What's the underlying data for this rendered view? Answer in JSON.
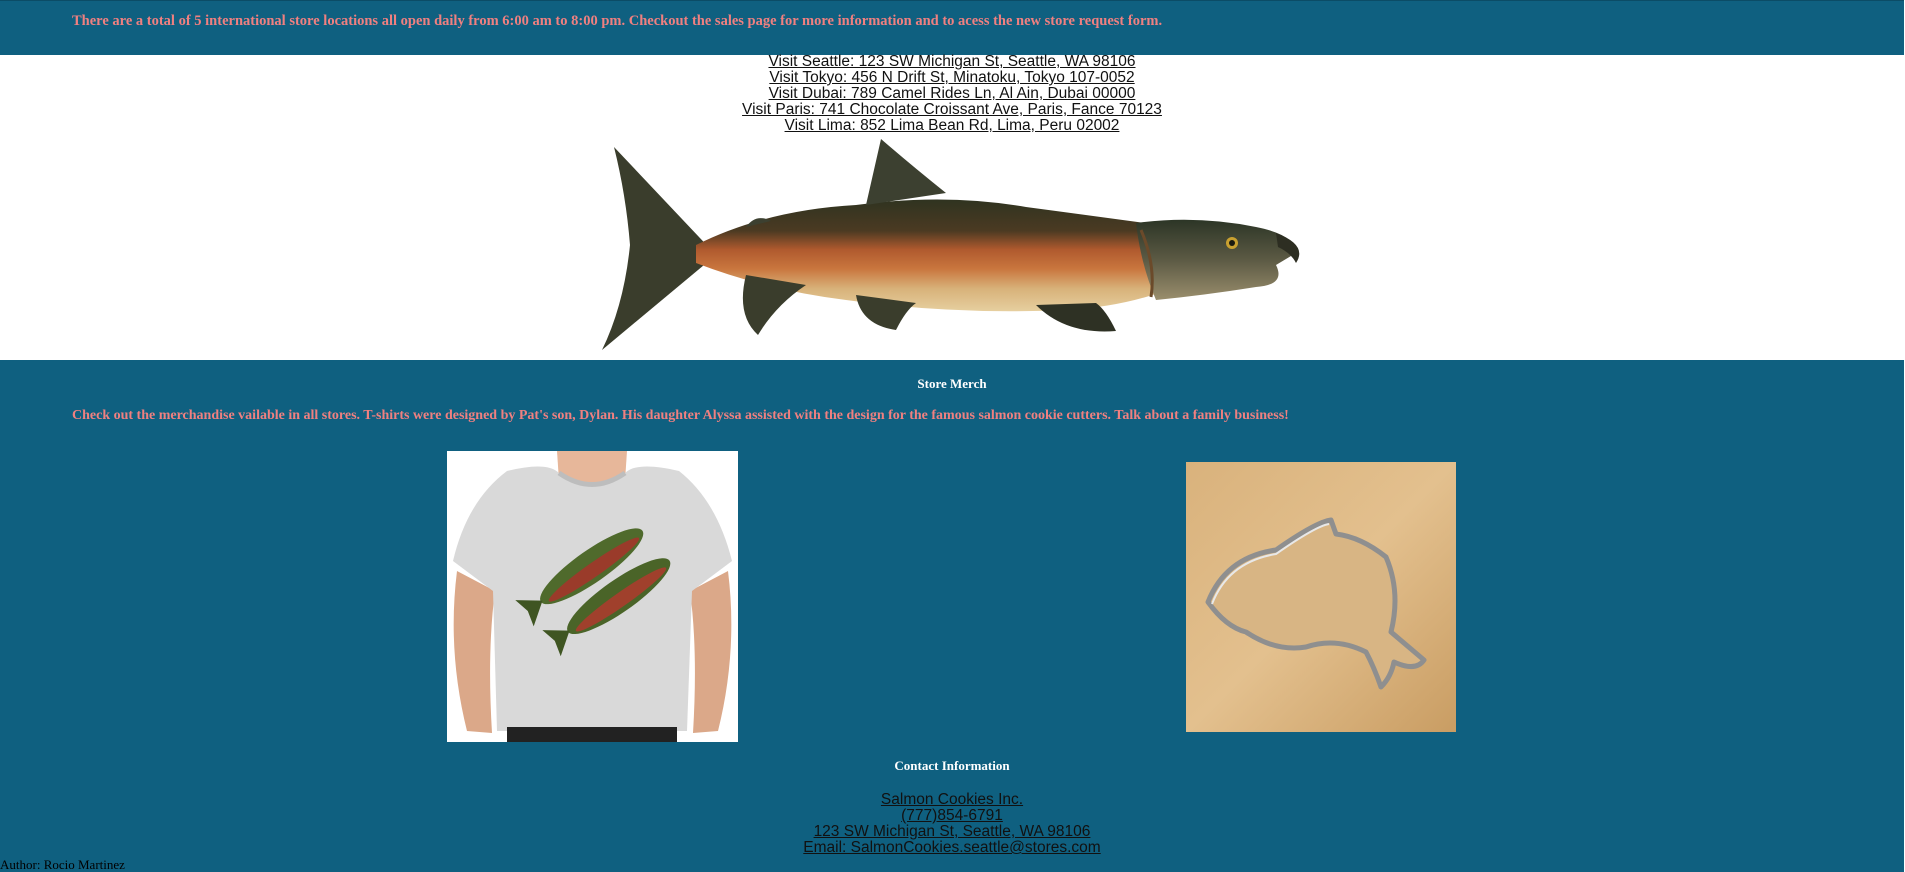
{
  "intro": {
    "text": "There are a total of 5 international store locations all open daily from 6:00 am to 8:00 pm. Checkout the sales page for more information and to acess the new store request form."
  },
  "locations": [
    {
      "label": "Visit Seattle: 123 SW Michigan St, Seattle, WA 98106"
    },
    {
      "label": "Visit Tokyo: 456 N Drift St, Minatoku, Tokyo 107-0052"
    },
    {
      "label": "Visit Dubai: 789 Camel Rides Ln, Al Ain, Dubai 00000"
    },
    {
      "label": "Visit Paris: 741 Chocolate Croissant Ave, Paris, Fance 70123"
    },
    {
      "label": "Visit Lima: 852 Lima Bean Rd, Lima, Peru 02002"
    }
  ],
  "merch": {
    "heading": "Store Merch",
    "text": "Check out the merchandise vailable in all stores. T-shirts were designed by Pat's son, Dylan. His daughter Alyssa assisted with the design for the famous salmon cookie cutters. Talk about a family business!"
  },
  "contact": {
    "heading": "Contact Information",
    "company": "Salmon Cookies Inc.",
    "phone": "(777)854-6791",
    "address": "123 SW Michigan St, Seattle, WA 98106",
    "email": "Email: SalmonCookies.seattle@stores.com"
  },
  "footer": {
    "author": "Author: Rocio Martinez"
  },
  "colors": {
    "band": "#0f6080",
    "accent_text": "#f08080",
    "heading_text": "#ffffff"
  }
}
